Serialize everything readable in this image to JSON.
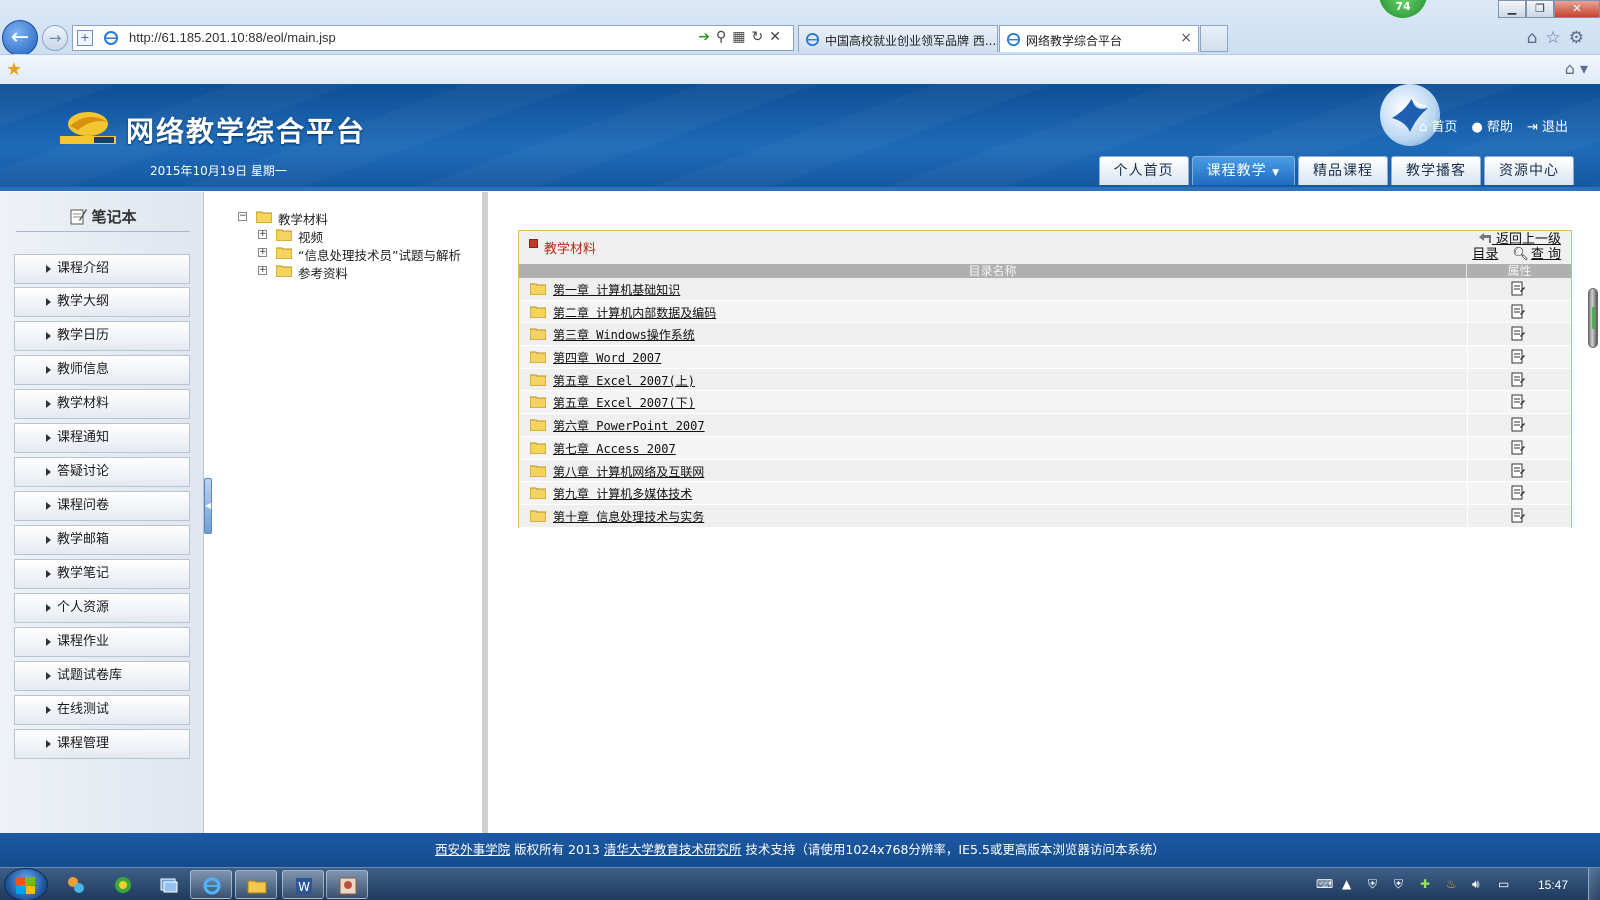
{
  "browser": {
    "url": "http://61.185.201.10:88/eol/main.jsp",
    "tabs": [
      {
        "label": "中国高校就业创业领军品牌 西..."
      },
      {
        "label": "网络教学综合平台"
      }
    ],
    "badge": "74"
  },
  "header": {
    "title": "网络教学综合平台",
    "date": "2015年10月19日 星期一",
    "links": [
      {
        "label": "首页",
        "icon": "home-icon"
      },
      {
        "label": "帮助",
        "icon": "help-icon"
      },
      {
        "label": "退出",
        "icon": "logout-icon"
      }
    ],
    "nav": [
      {
        "label": "个人首页"
      },
      {
        "label": "课程教学",
        "active": true
      },
      {
        "label": "精品课程"
      },
      {
        "label": "教学播客"
      },
      {
        "label": "资源中心"
      }
    ]
  },
  "sidebar": {
    "title": "笔记本",
    "items": [
      {
        "label": "课程介绍"
      },
      {
        "label": "教学大纲"
      },
      {
        "label": "教学日历"
      },
      {
        "label": "教师信息"
      },
      {
        "label": "教学材料"
      },
      {
        "label": "课程通知"
      },
      {
        "label": "答疑讨论"
      },
      {
        "label": "课程问卷"
      },
      {
        "label": "教学邮箱"
      },
      {
        "label": "教学笔记"
      },
      {
        "label": "个人资源"
      },
      {
        "label": "课程作业"
      },
      {
        "label": "试题试卷库"
      },
      {
        "label": "在线测试"
      },
      {
        "label": "课程管理"
      }
    ]
  },
  "tree": {
    "root": {
      "label": "教学材料",
      "toggle": "⊟"
    },
    "children": [
      {
        "label": "视频",
        "toggle": "+"
      },
      {
        "label": "“信息处理技术员”试题与解析",
        "toggle": "+"
      },
      {
        "label": "参考资料",
        "toggle": "+"
      }
    ]
  },
  "content": {
    "title": "教学材料",
    "back_link": "返回上一级",
    "dir_label": "目录",
    "search_label": "查 询",
    "columns": {
      "name": "目录名称",
      "prop": "属性"
    },
    "rows": [
      {
        "name": "第一章 计算机基础知识"
      },
      {
        "name": "第二章 计算机内部数据及编码"
      },
      {
        "name": "第三章 Windows操作系统"
      },
      {
        "name": "第四章 Word 2007"
      },
      {
        "name": "第五章 Excel 2007(上)"
      },
      {
        "name": "第五章 Excel 2007(下)"
      },
      {
        "name": "第六章 PowerPoint 2007"
      },
      {
        "name": "第七章 Access 2007"
      },
      {
        "name": "第八章 计算机网络及互联网"
      },
      {
        "name": "第九章 计算机多媒体技术"
      },
      {
        "name": "第十章 信息处理技术与实务"
      }
    ]
  },
  "footer": {
    "org": "西安外事学院",
    "copyright": "版权所有 2013",
    "tech": "清华大学教育技术研究所",
    "note": "技术支持（请使用1024x768分辨率，IE5.5或更高版本浏览器访问本系统）"
  },
  "taskbar": {
    "clock": "15:47"
  },
  "colors": {
    "header_blue": "#1e6bb8",
    "content_border": "#e9b65a",
    "content_title": "#b4281a",
    "active_nav": "#1f6cbf"
  }
}
